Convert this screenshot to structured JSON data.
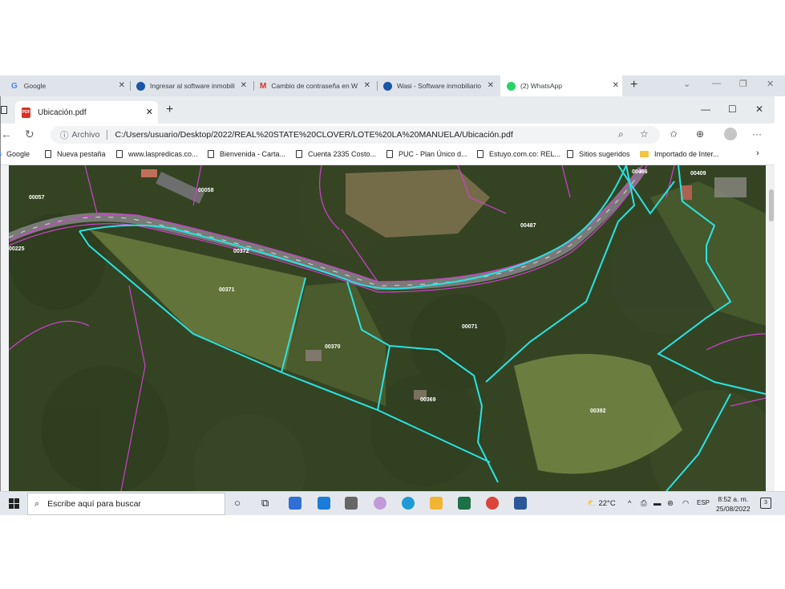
{
  "outer_tabs": [
    {
      "label": "Google",
      "icon": "google-icon",
      "color": "#4285f4"
    },
    {
      "label": "Ingresar al software inmobili",
      "icon": "wasi-icon",
      "color": "#1a56a8"
    },
    {
      "label": "Cambio de contraseña en W",
      "icon": "gmail-icon",
      "color": "#d93025"
    },
    {
      "label": "Wasi - Software inmobiliario",
      "icon": "wasi-icon",
      "color": "#1a56a8"
    },
    {
      "label": "(2) WhatsApp",
      "icon": "whatsapp-icon",
      "color": "#25d366"
    }
  ],
  "inner_tab": {
    "label": "Ubicación.pdf",
    "icon_text": "PDF"
  },
  "address": {
    "prefix": "Archivo",
    "url": "C:/Users/usuario/Desktop/2022/REAL%20STATE%20CLOVER/LOTE%20LA%20MANUELA/Ubicación.pdf"
  },
  "bookmarks": [
    {
      "label": "Google",
      "type": "google"
    },
    {
      "label": "Nueva pestaña",
      "type": "page"
    },
    {
      "label": "www.laspredicas.co...",
      "type": "page"
    },
    {
      "label": "Bienvenida - Carta...",
      "type": "page"
    },
    {
      "label": "Cuenta 2335 Costo...",
      "type": "page"
    },
    {
      "label": "PUC - Plan Único d...",
      "type": "page"
    },
    {
      "label": "Estuyo.com.co: REL...",
      "type": "page"
    },
    {
      "label": "Sitios sugeridos",
      "type": "page"
    },
    {
      "label": "Importado de Inter...",
      "type": "folder"
    }
  ],
  "map_labels": {
    "l00057": "00057",
    "l00058": "00058",
    "l00486": "00486",
    "l00409": "00409",
    "l00225": "00225",
    "l00372": "00372",
    "l00487": "00487",
    "l00371": "00371",
    "l00071": "00071",
    "l00370": "00370",
    "l00369": "00369",
    "l00392": "00392"
  },
  "taskbar": {
    "search_placeholder": "Escribe aquí para buscar",
    "temperature": "22°C",
    "language": "ESP",
    "time": "8:52 a. m.",
    "date": "25/08/2022",
    "notifications": "3"
  }
}
